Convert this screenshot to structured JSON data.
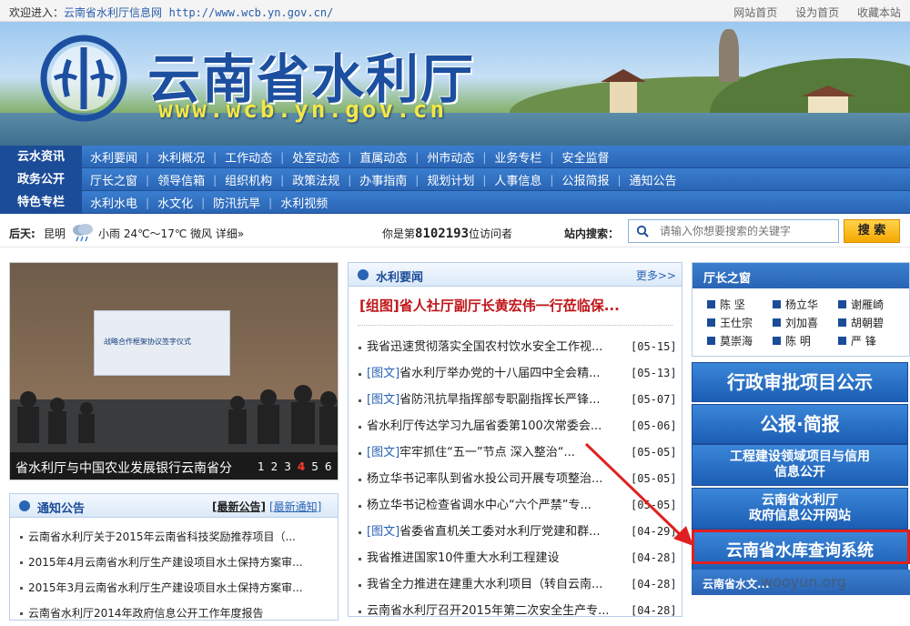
{
  "topbar": {
    "welcome_prefix": "欢迎进入：",
    "site_name": "云南省水利厅信息网",
    "site_url": "http://www.wcb.yn.gov.cn/",
    "links": [
      "网站首页",
      "设为首页",
      "收藏本站"
    ]
  },
  "banner": {
    "title": "云南省水利厅",
    "url": "www.wcb.yn.gov.cn"
  },
  "nav": {
    "rows": [
      {
        "category": "云水资讯",
        "items": [
          "水利要闻",
          "水利概况",
          "工作动态",
          "处室动态",
          "直属动态",
          "州市动态",
          "业务专栏",
          "安全监督"
        ]
      },
      {
        "category": "政务公开",
        "items": [
          "厅长之窗",
          "领导信箱",
          "组织机构",
          "政策法规",
          "办事指南",
          "规划计划",
          "人事信息",
          "公报简报",
          "通知公告"
        ]
      },
      {
        "category": "特色专栏",
        "items": [
          "水利水电",
          "水文化",
          "防汛抗旱",
          "水利视频"
        ]
      }
    ]
  },
  "weather": {
    "label": "后天:",
    "city": "昆明",
    "condition": "小雨 24℃～17℃ 微风 详细»"
  },
  "visits": {
    "prefix": "你是第",
    "count": "8102193",
    "suffix": "位访问者"
  },
  "search": {
    "label": "站内搜索：",
    "placeholder": "请输入你想要搜索的关键字",
    "button": "搜 索"
  },
  "slideshow": {
    "caption": "省水利厅与中国农业发展银行云南省分",
    "pages": [
      "1",
      "2",
      "3",
      "4",
      "5",
      "6"
    ],
    "active_page": "4",
    "screen_text": "战略合作框架协议签字仪式"
  },
  "notice": {
    "title": "通知公告",
    "tab_latest": "[最新公告]",
    "tab_notice": "[最新通知]",
    "items": [
      "云南省水利厅关于2015年云南省科技奖励推荐项目（...",
      "2015年4月云南省水利厅生产建设项目水土保持方案审...",
      "2015年3月云南省水利厅生产建设项目水土保持方案审...",
      "云南省水利厅2014年政府信息公开工作年度报告"
    ]
  },
  "news": {
    "title": "水利要闻",
    "more": "更多>>",
    "headline": "[组图]省人社厅副厅长黄宏伟一行莅临保...",
    "items": [
      {
        "tag": "",
        "title": "我省迅速贯彻落实全国农村饮水安全工作视...",
        "date": "[05-15]"
      },
      {
        "tag": "[图文]",
        "title": "省水利厅举办党的十八届四中全会精...",
        "date": "[05-13]"
      },
      {
        "tag": "[图文]",
        "title": "省防汛抗旱指挥部专职副指挥长严锋...",
        "date": "[05-07]"
      },
      {
        "tag": "",
        "title": "省水利厅传达学习九届省委第100次常委会...",
        "date": "[05-06]"
      },
      {
        "tag": "[图文]",
        "title": "牢牢抓住“五一”节点 深入整治“...",
        "date": "[05-05]"
      },
      {
        "tag": "",
        "title": "杨立华书记率队到省水投公司开展专项整治...",
        "date": "[05-05]"
      },
      {
        "tag": "",
        "title": "杨立华书记检查省调水中心“六个严禁”专...",
        "date": "[05-05]"
      },
      {
        "tag": "[图文]",
        "title": "省委省直机关工委对水利厅党建和群...",
        "date": "[04-29]"
      },
      {
        "tag": "",
        "title": "我省推进国家10件重大水利工程建设",
        "date": "[04-28]"
      },
      {
        "tag": "",
        "title": "我省全力推进在建重大水利项目（转自云南...",
        "date": "[04-28]"
      },
      {
        "tag": "",
        "title": "云南省水利厅召开2015年第二次安全生产专...",
        "date": "[04-28]"
      }
    ]
  },
  "leaders": {
    "title": "厅长之窗",
    "names": [
      "陈 坚",
      "杨立华",
      "谢雁崎",
      "王仕宗",
      "刘加喜",
      "胡朝碧",
      "莫崇海",
      "陈 明",
      "严 锋"
    ]
  },
  "promos": {
    "p1": "行政审批项目公示",
    "p2": "公报·简报",
    "p3_line1": "工程建设领域项目与信用",
    "p3_line2": "信息公开",
    "p4_line1": "云南省水利厅",
    "p4_line2": "政府信息公开网站",
    "p5": "云南省水库查询系统"
  },
  "sub_section": {
    "title": "云南省水文..."
  },
  "watermark": "wooyun.org",
  "colors": {
    "nav_blue": "#2a64b4",
    "headline_red": "#c0161a",
    "search_button": "#f5a800",
    "highlight_red": "#e02020"
  }
}
